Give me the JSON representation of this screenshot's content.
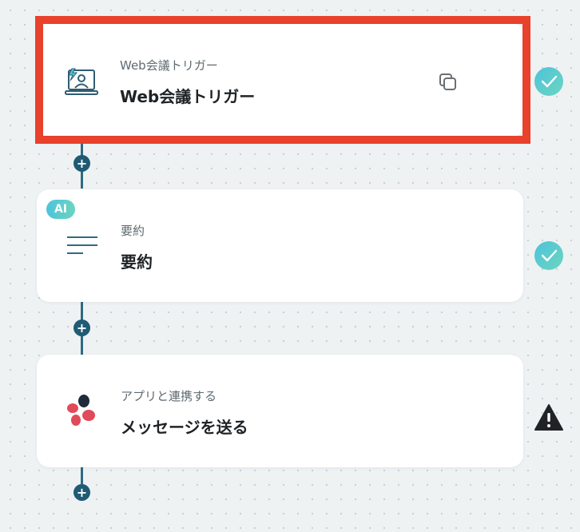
{
  "flow": {
    "add_step_label": "+",
    "steps": [
      {
        "subtitle": "Web会議トリガー",
        "title": "Web会議トリガー",
        "icon": "video-meeting-icon",
        "status": "completed",
        "selected": true
      },
      {
        "badge": "AI",
        "subtitle": "要約",
        "title": "要約",
        "icon": "summary-lines-icon",
        "status": "completed"
      },
      {
        "subtitle": "アプリと連携する",
        "title": "メッセージを送る",
        "icon": "app-logo-icon",
        "status": "warning"
      }
    ]
  },
  "colors": {
    "selection_border": "#e8412c",
    "connector": "#2f6a82",
    "add_button": "#1f5b74",
    "check_gradient_start": "#4ec3da",
    "check_gradient_end": "#6bd5c0",
    "warning": "#1f2326",
    "logo_red": "#e04a5a",
    "logo_dark": "#1f2a3a"
  }
}
